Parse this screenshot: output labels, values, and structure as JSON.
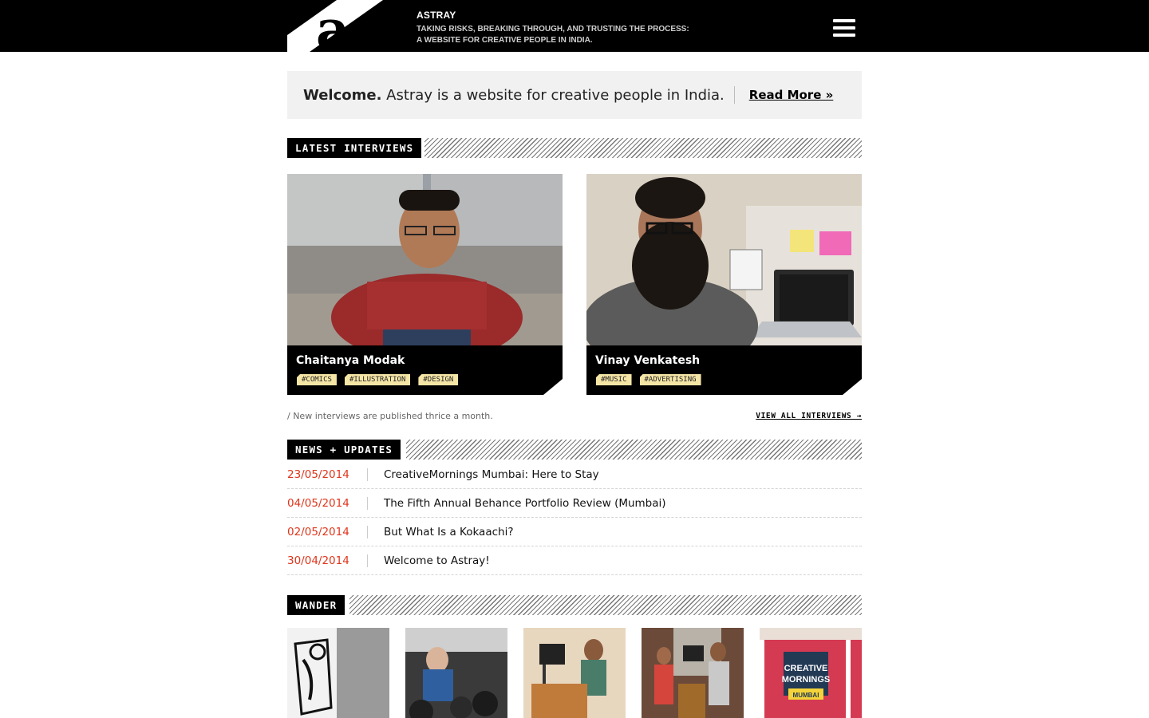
{
  "header": {
    "logo_letter": "a",
    "site_name": "ASTRAY",
    "tagline_1": "TAKING RISKS, BREAKING THROUGH, AND TRUSTING THE PROCESS:",
    "tagline_2": "A WEBSITE FOR CREATIVE PEOPLE IN INDIA.",
    "menu_icon": "hamburger-menu-icon"
  },
  "welcome": {
    "bold": "Welcome.",
    "text": " Astray is a website for creative people in India.",
    "link": "Read More »"
  },
  "interviews": {
    "heading": "LATEST INTERVIEWS",
    "cards": [
      {
        "name": "Chaitanya Modak",
        "tags": [
          "#COMICS",
          "#ILLUSTRATION",
          "#DESIGN"
        ]
      },
      {
        "name": "Vinay Venkatesh",
        "tags": [
          "#MUSIC",
          "#ADVERTISING"
        ]
      }
    ],
    "note": "/ New interviews are published thrice a month.",
    "view_all": "VIEW ALL INTERVIEWS →"
  },
  "news": {
    "heading": "NEWS + UPDATES",
    "items": [
      {
        "date": "23/05/2014",
        "title": "CreativeMornings Mumbai: Here to Stay"
      },
      {
        "date": "04/05/2014",
        "title": "The Fifth Annual Behance Portfolio Review (Mumbai)"
      },
      {
        "date": "02/05/2014",
        "title": "But What Is a Kokaachi?"
      },
      {
        "date": "30/04/2014",
        "title": "Welcome to Astray!"
      }
    ]
  },
  "wander": {
    "heading": "WANDER",
    "thumb_5_lines": [
      "CREATIVE",
      "MORNINGS",
      "MUMBAI"
    ]
  },
  "colors": {
    "accent_date": "#e0351b",
    "tag_bg": "#f5e6a6",
    "bar": "#000000"
  }
}
